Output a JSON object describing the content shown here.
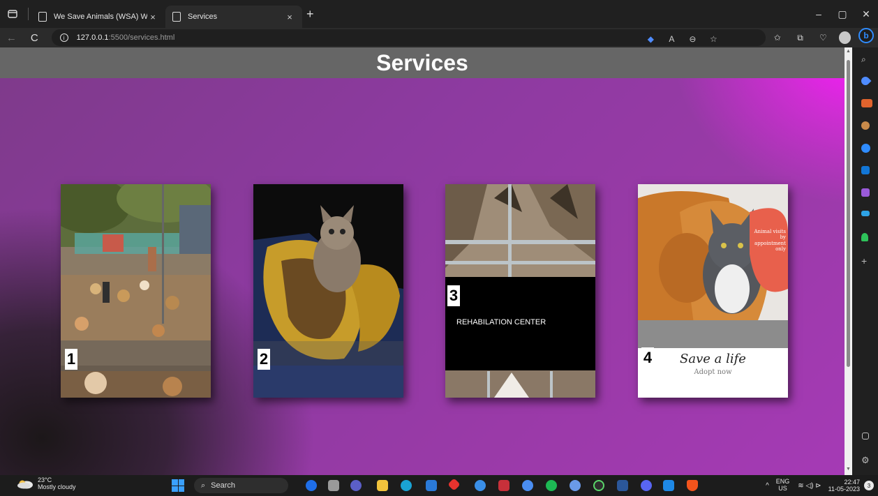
{
  "browser": {
    "tabs": [
      {
        "title": "We Save Animals (WSA) Welfare",
        "active": false
      },
      {
        "title": "Services",
        "active": true
      }
    ],
    "url_host": "127.0.0.1",
    "url_path": ":5500/services.html",
    "new_tab": "+",
    "close": "×",
    "min": "–",
    "restore": "▢",
    "win_close": "✕",
    "back": "←",
    "reload": "C",
    "more": "···",
    "bing": "b"
  },
  "page": {
    "title": "Services",
    "cards": [
      {
        "number": "1",
        "label": ""
      },
      {
        "number": "2",
        "label": ""
      },
      {
        "number": "3",
        "label": "REHABILATION CENTER"
      },
      {
        "number": "4",
        "label": "",
        "image_text_main": "Save a life",
        "image_text_sub": "Adopt now",
        "image_badge": "Animal visits by appointment only"
      }
    ]
  },
  "taskbar": {
    "weather_temp": "23°C",
    "weather_desc": "Mostly cloudy",
    "search_label": "Search",
    "lang_top": "ENG",
    "lang_bottom": "US",
    "time": "22:47",
    "date": "11-05-2023",
    "notifications": "3",
    "tray_chevron": "^",
    "tray_icons": "≋ ◁) ⊳"
  },
  "colors": {
    "accent_magenta": "#ff18ff",
    "header_gray": "#666666",
    "edge_blue": "#2f8cff"
  }
}
